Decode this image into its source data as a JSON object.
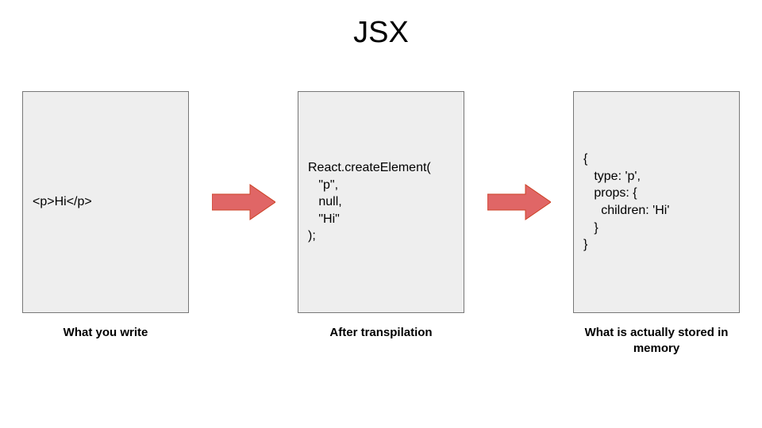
{
  "title": "JSX",
  "panels": [
    {
      "code": "<p>Hi</p>",
      "caption": "What you write"
    },
    {
      "code": "React.createElement(\n   \"p\",\n   null,\n   \"Hi\"\n);",
      "caption": "After transpilation"
    },
    {
      "code": "{\n   type: 'p',\n   props: {\n     children: 'Hi'\n   }\n}",
      "caption": "What is actually stored\nin memory"
    }
  ],
  "colors": {
    "panel_bg": "#eeeeee",
    "panel_border": "#777777",
    "arrow_fill": "#e06666",
    "arrow_stroke": "#cc4125"
  }
}
